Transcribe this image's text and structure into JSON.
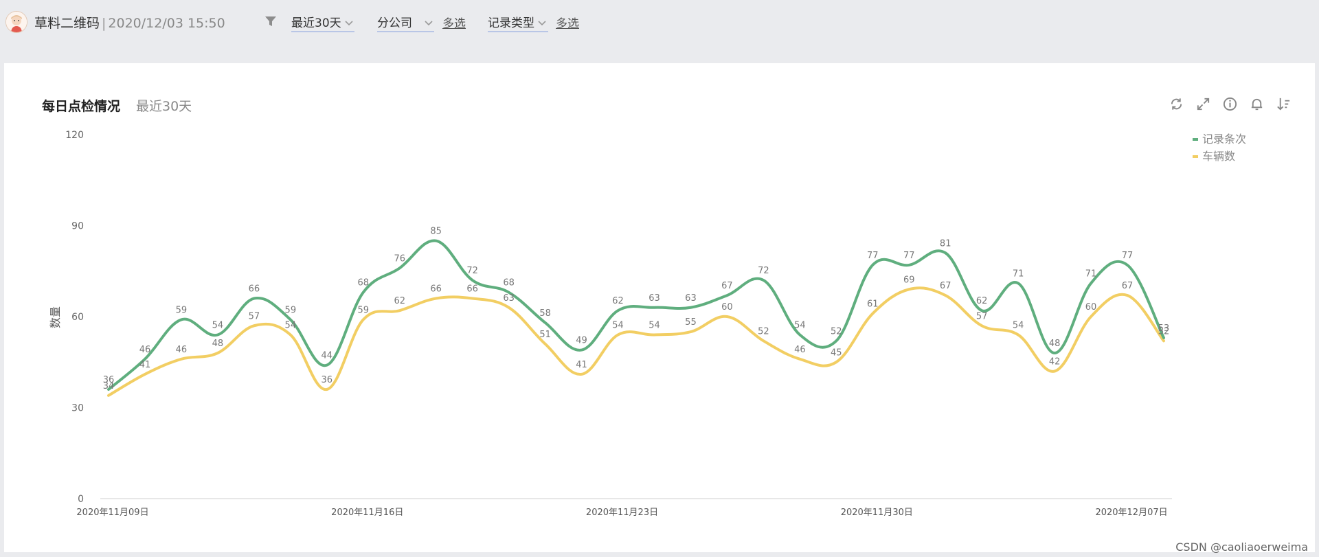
{
  "header": {
    "app_title": "草料二维码",
    "separator": "|",
    "timestamp": "2020/12/03 15:50",
    "filters": {
      "date_range": "最近30天",
      "branch": "分公司",
      "branch_multi": "多选",
      "record_type": "记录类型",
      "record_type_multi": "多选"
    }
  },
  "card": {
    "title": "每日点检情况",
    "subtitle": "最近30天",
    "tools": [
      "refresh-icon",
      "expand-icon",
      "info-icon",
      "bell-icon",
      "sort-icon"
    ]
  },
  "watermark": "CSDN @caoliaoerweima",
  "chart_data": {
    "type": "line",
    "smooth": true,
    "ylabel": "数量",
    "ylim": [
      0,
      120
    ],
    "yticks": [
      0,
      30,
      60,
      90,
      120
    ],
    "x_tick_labels": [
      "2020年11月09日",
      "2020年11月16日",
      "2020年11月23日",
      "2020年11月30日",
      "2020年12月07日"
    ],
    "x_tick_indices": [
      0,
      7,
      14,
      21,
      28
    ],
    "legend_position": "top-right",
    "grid": false,
    "series": [
      {
        "name": "记录条次",
        "color": "#5fae7e",
        "values": [
          36,
          46,
          59,
          54,
          66,
          59,
          44,
          68,
          76,
          85,
          72,
          68,
          58,
          49,
          62,
          63,
          63,
          67,
          72,
          54,
          52,
          77,
          77,
          81,
          62,
          71,
          48,
          71,
          77,
          53
        ]
      },
      {
        "name": "车辆数",
        "color": "#f2ce63",
        "values": [
          34,
          41,
          46,
          48,
          57,
          54,
          36,
          59,
          62,
          66,
          66,
          63,
          51,
          41,
          54,
          54,
          55,
          60,
          52,
          46,
          45,
          61,
          69,
          67,
          57,
          54,
          42,
          60,
          67,
          52
        ]
      }
    ]
  }
}
